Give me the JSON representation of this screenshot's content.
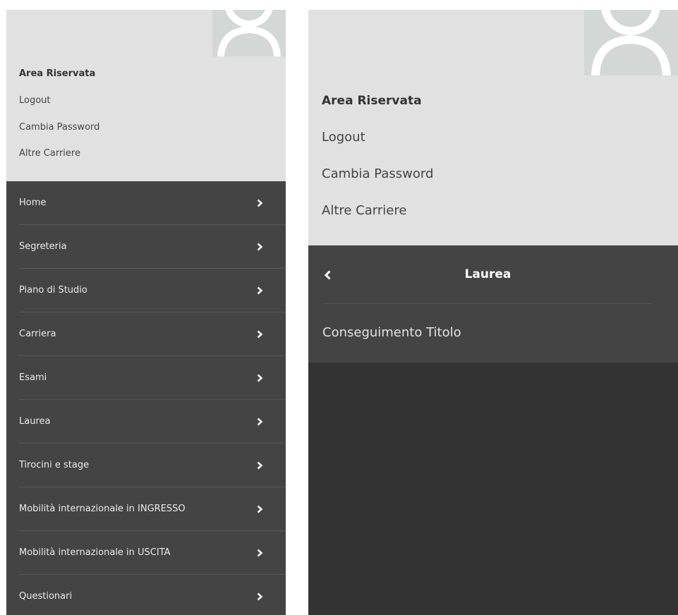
{
  "left_panel": {
    "user_area": {
      "title": "Area Riservata",
      "links": [
        "Logout",
        "Cambia Password",
        "Altre Carriere"
      ],
      "avatar_icon": "user-avatar-icon"
    },
    "menu": [
      {
        "label": "Home"
      },
      {
        "label": "Segreteria"
      },
      {
        "label": "Piano di Studio"
      },
      {
        "label": "Carriera"
      },
      {
        "label": "Esami"
      },
      {
        "label": "Laurea"
      },
      {
        "label": "Tirocini e stage"
      },
      {
        "label": "Mobilità internazionale in INGRESSO"
      },
      {
        "label": "Mobilità internazionale in USCITA"
      },
      {
        "label": "Questionari"
      }
    ],
    "chevron_icon": "chevron-right-icon"
  },
  "right_panel": {
    "user_area": {
      "title": "Area Riservata",
      "links": [
        "Logout",
        "Cambia Password",
        "Altre Carriere"
      ],
      "avatar_icon": "user-avatar-icon"
    },
    "submenu": {
      "title": "Laurea",
      "back_icon": "chevron-left-icon",
      "items": [
        {
          "label": "Conseguimento Titolo"
        }
      ]
    }
  },
  "colors": {
    "user_area_bg": "#e1e1e1",
    "menu_bg": "#444444",
    "panel_bg": "#333333",
    "avatar_bg": "#d3d7d6",
    "menu_text": "#eaeaea",
    "divider": "#575757"
  }
}
